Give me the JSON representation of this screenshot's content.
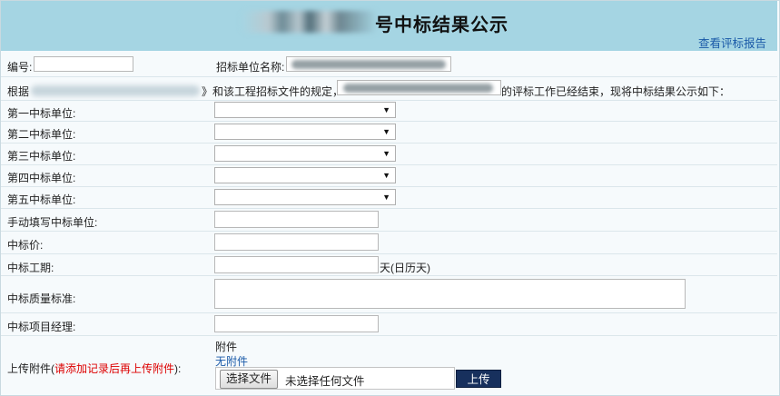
{
  "header": {
    "title": "号中标结果公示",
    "report_link": "查看评标报告"
  },
  "form": {
    "number_label": "编号:",
    "number_value": "",
    "tender_unit_label": "招标单位名称:",
    "intro_prefix": "根据",
    "intro_mid": "》和该工程招标文件的规定，",
    "intro_suffix": "的评标工作已经结束，现将中标结果公示如下：",
    "winners": [
      {
        "label": "第一中标单位:"
      },
      {
        "label": "第二中标单位:"
      },
      {
        "label": "第三中标单位:"
      },
      {
        "label": "第四中标单位:"
      },
      {
        "label": "第五中标单位:"
      }
    ],
    "manual_label": "手动填写中标单位:",
    "price_label": "中标价:",
    "period_label": "中标工期:",
    "period_unit": "天(日历天)",
    "quality_label": "中标质量标准:",
    "manager_label": "中标项目经理:",
    "upload_label": "上传附件(",
    "upload_note": "请添加记录后再上传附件",
    "upload_close": "):",
    "attachment_heading": "附件",
    "no_attachment": "无附件",
    "choose_file": "选择文件",
    "no_file": "未选择任何文件",
    "upload_button": "上传"
  }
}
